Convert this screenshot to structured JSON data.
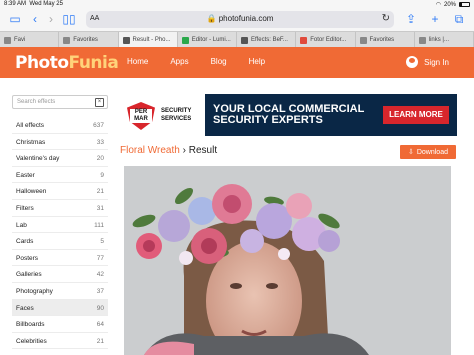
{
  "status": {
    "time": "8:39 AM",
    "date": "Wed May 25",
    "battery": "20%"
  },
  "browser": {
    "aa_label": "AA",
    "url": "photofunia.com",
    "tabs": [
      {
        "label": "Favi",
        "active": false,
        "color": "#888888"
      },
      {
        "label": "Favorites",
        "active": false,
        "color": "#888888"
      },
      {
        "label": "Result - Pho...",
        "active": true,
        "color": "#555555"
      },
      {
        "label": "Editor - Lumi...",
        "active": false,
        "color": "#2aa84a"
      },
      {
        "label": "Effects: BeF...",
        "active": false,
        "color": "#555555"
      },
      {
        "label": "Fotor Editor...",
        "active": false,
        "color": "#e04b3c"
      },
      {
        "label": "Favorites",
        "active": false,
        "color": "#888888"
      },
      {
        "label": "links |...",
        "active": false,
        "color": "#888888"
      }
    ]
  },
  "site": {
    "logo_part1": "Photo",
    "logo_part2": "Funia",
    "nav": [
      "Home",
      "Apps",
      "Blog",
      "Help"
    ],
    "signin": "Sign In"
  },
  "sidebar": {
    "search_placeholder": "Search effects",
    "categories": [
      {
        "name": "All effects",
        "count": "637"
      },
      {
        "name": "Christmas",
        "count": "33"
      },
      {
        "name": "Valentine's day",
        "count": "20"
      },
      {
        "name": "Easter",
        "count": "9"
      },
      {
        "name": "Halloween",
        "count": "21"
      },
      {
        "name": "Filters",
        "count": "31"
      },
      {
        "name": "Lab",
        "count": "111"
      },
      {
        "name": "Cards",
        "count": "5"
      },
      {
        "name": "Posters",
        "count": "77"
      },
      {
        "name": "Galleries",
        "count": "42"
      },
      {
        "name": "Photography",
        "count": "37"
      },
      {
        "name": "Faces",
        "count": "90"
      },
      {
        "name": "Billboards",
        "count": "64"
      },
      {
        "name": "Celebrities",
        "count": "21"
      }
    ],
    "active_index": 11
  },
  "ad": {
    "logo_text_1": "PER",
    "logo_text_2": "MAR",
    "brand_1": "SECURITY",
    "brand_2": "SERVICES",
    "headline_1": "YOUR LOCAL COMMERCIAL",
    "headline_2": "SECURITY EXPERTS",
    "cta": "LEARN MORE"
  },
  "content": {
    "breadcrumb_link": "Floral Wreath",
    "breadcrumb_sep": "›",
    "breadcrumb_current": "Result",
    "download_label": "Download"
  },
  "colors": {
    "brand": "#f06a35",
    "ad_bg": "#0a2746",
    "ad_red": "#d8262c"
  }
}
